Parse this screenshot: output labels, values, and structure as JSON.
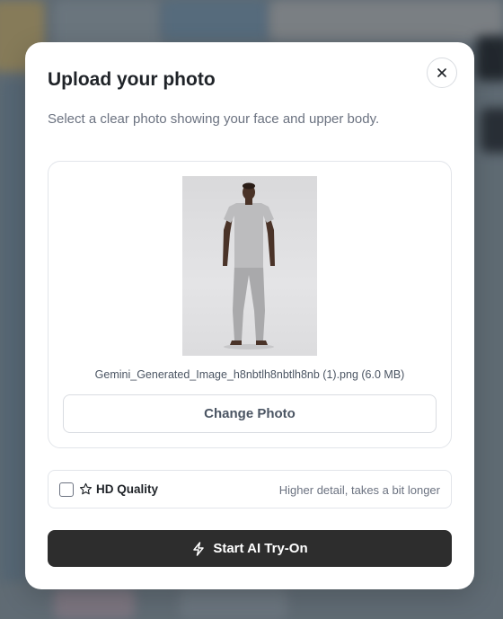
{
  "modal": {
    "title": "Upload your photo",
    "subtitle": "Select a clear photo showing your face and upper body.",
    "close_icon": "close-icon"
  },
  "photo": {
    "file_label": "Gemini_Generated_Image_h8nbtlh8nbtlh8nb (1).png (6.0 MB)",
    "change_label": "Change Photo"
  },
  "hd": {
    "label": "HD Quality",
    "hint": "Higher detail, takes a bit longer",
    "checked": false,
    "icon": "star-icon"
  },
  "start": {
    "label": "Start AI Try-On",
    "icon": "lightning-icon"
  },
  "colors": {
    "primary_button": "#2d2d2d",
    "border": "#e2e5ea",
    "muted_text": "#6b7280"
  }
}
